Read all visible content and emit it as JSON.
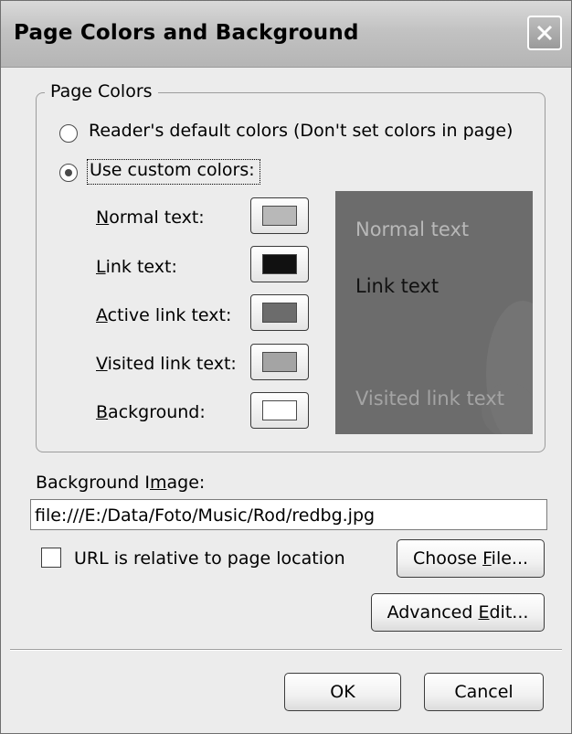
{
  "window": {
    "title": "Page Colors and Background"
  },
  "page_colors": {
    "group_label": "Page Colors",
    "option_default": "Reader's default colors (Don't set colors in page)",
    "option_custom": "Use custom colors:",
    "selected": "custom",
    "items": [
      {
        "mnemonic": "N",
        "rest": "ormal text:",
        "color": "#b8b8b8"
      },
      {
        "mnemonic": "L",
        "rest": "ink text:",
        "color": "#111111"
      },
      {
        "mnemonic": "A",
        "rest": "ctive link text:",
        "color": "#6c6c6c"
      },
      {
        "mnemonic": "V",
        "rest": "isited link text:",
        "color": "#a4a4a4"
      },
      {
        "mnemonic": "B",
        "rest": "ackground:",
        "color": "#ffffff"
      }
    ],
    "preview": {
      "normal_text": "Normal text",
      "link_text": "Link text",
      "visited_text": "Visited link text",
      "background_color": "#6c6c6c"
    }
  },
  "background_image": {
    "label_before": "Background I",
    "label_mnemonic": "m",
    "label_after": "age:",
    "value": "file:///E:/Data/Foto/Music/Rod/redbg.jpg",
    "relative_label": "URL is relative to page location",
    "relative_checked": false,
    "choose_before": "Choose ",
    "choose_mnemonic": "F",
    "choose_after": "ile..."
  },
  "advanced": {
    "before": "Advanced ",
    "mnemonic": "E",
    "after": "dit..."
  },
  "footer": {
    "ok_label": "OK",
    "cancel_label": "Cancel"
  }
}
